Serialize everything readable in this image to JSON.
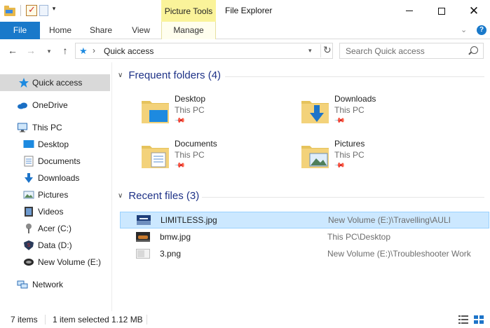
{
  "window": {
    "title": "File Explorer",
    "context_tab_group": "Picture Tools"
  },
  "ribbon": {
    "tabs": [
      "File",
      "Home",
      "Share",
      "View",
      "Manage"
    ]
  },
  "address": {
    "path": "Quick access",
    "search_placeholder": "Search Quick access"
  },
  "sidebar": {
    "items": [
      {
        "label": "Quick access",
        "icon": "star-icon",
        "selected": true
      },
      {
        "label": "OneDrive",
        "icon": "cloud-icon"
      },
      {
        "label": "This PC",
        "icon": "computer-icon"
      },
      {
        "label": "Desktop",
        "icon": "desktop-icon"
      },
      {
        "label": "Documents",
        "icon": "documents-icon"
      },
      {
        "label": "Downloads",
        "icon": "download-icon"
      },
      {
        "label": "Pictures",
        "icon": "pictures-icon"
      },
      {
        "label": "Videos",
        "icon": "videos-icon"
      },
      {
        "label": "Acer (C:)",
        "icon": "drive-icon"
      },
      {
        "label": "Data (D:)",
        "icon": "drive-icon"
      },
      {
        "label": "New Volume (E:)",
        "icon": "drive-icon"
      },
      {
        "label": "Network",
        "icon": "network-icon"
      }
    ]
  },
  "frequent": {
    "header": "Frequent folders (4)",
    "folders": [
      {
        "name": "Desktop",
        "location": "This PC",
        "icon": "desktop-folder-icon"
      },
      {
        "name": "Downloads",
        "location": "This PC",
        "icon": "downloads-folder-icon"
      },
      {
        "name": "Documents",
        "location": "This PC",
        "icon": "documents-folder-icon"
      },
      {
        "name": "Pictures",
        "location": "This PC",
        "icon": "pictures-folder-icon"
      }
    ]
  },
  "recent": {
    "header": "Recent files (3)",
    "files": [
      {
        "name": "LIMITLESS.jpg",
        "path": "New Volume (E:)\\Travelling\\AULI",
        "selected": true
      },
      {
        "name": "bmw.jpg",
        "path": "This PC\\Desktop"
      },
      {
        "name": "3.png",
        "path": "New Volume (E:)\\Troubleshooter Work"
      }
    ]
  },
  "status": {
    "item_count": "7 items",
    "selection": "1 item selected",
    "size": "1.12 MB"
  },
  "colors": {
    "accent": "#1979ca",
    "selection": "#cce8ff",
    "group_header": "#1e3287",
    "context_tab": "#faf39a"
  }
}
